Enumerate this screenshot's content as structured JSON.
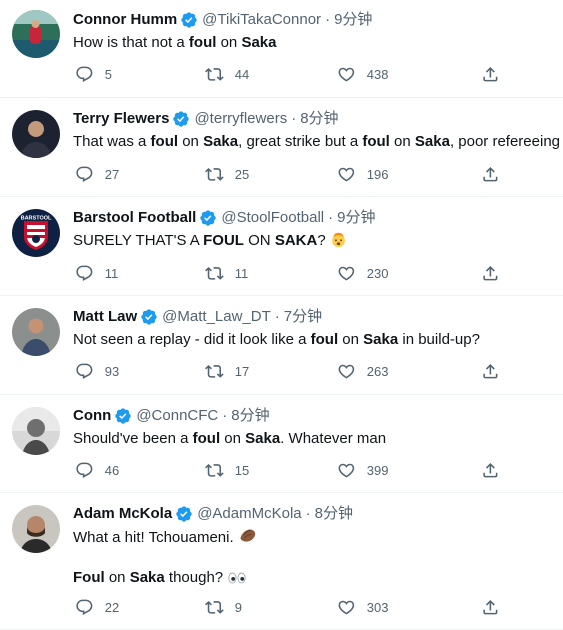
{
  "tweets": [
    {
      "name": "Connor Humm",
      "handle": "@TikiTakaConnor",
      "time": "9分钟",
      "segments": [
        {
          "t": "How is that not a "
        },
        {
          "t": "foul",
          "b": true
        },
        {
          "t": " on "
        },
        {
          "t": "Saka",
          "b": true
        }
      ],
      "replies": "5",
      "retweets": "44",
      "likes": "438"
    },
    {
      "name": "Terry Flewers",
      "handle": "@terryflewers",
      "time": "8分钟",
      "segments": [
        {
          "t": "That was a "
        },
        {
          "t": "foul",
          "b": true
        },
        {
          "t": " on "
        },
        {
          "t": "Saka",
          "b": true
        },
        {
          "t": ", great strike but a "
        },
        {
          "t": "foul",
          "b": true
        },
        {
          "t": " on "
        },
        {
          "t": "Saka",
          "b": true
        },
        {
          "t": ", poor refereeing"
        }
      ],
      "replies": "27",
      "retweets": "25",
      "likes": "196"
    },
    {
      "name": "Barstool Football",
      "handle": "@StoolFootball",
      "time": "9分钟",
      "segments": [
        {
          "t": "SURELY THAT'S A "
        },
        {
          "t": "FOUL",
          "b": true
        },
        {
          "t": " ON "
        },
        {
          "t": "SAKA",
          "b": true
        },
        {
          "t": "? "
        }
      ],
      "emoji": "exploding-head-emoji",
      "replies": "11",
      "retweets": "11",
      "likes": "230"
    },
    {
      "name": "Matt Law",
      "handle": "@Matt_Law_DT",
      "time": "7分钟",
      "segments": [
        {
          "t": "Not seen a replay - did it look like a "
        },
        {
          "t": "foul",
          "b": true
        },
        {
          "t": " on "
        },
        {
          "t": "Saka",
          "b": true
        },
        {
          "t": " in build-up?"
        }
      ],
      "replies": "93",
      "retweets": "17",
      "likes": "263"
    },
    {
      "name": "Conn",
      "handle": "@ConnCFC",
      "time": "8分钟",
      "segments": [
        {
          "t": "Should've been a "
        },
        {
          "t": "foul",
          "b": true
        },
        {
          "t": " on "
        },
        {
          "t": "Saka",
          "b": true
        },
        {
          "t": ". Whatever man"
        }
      ],
      "replies": "46",
      "retweets": "15",
      "likes": "399"
    },
    {
      "name": "Adam McKola",
      "handle": "@AdamMcKola",
      "time": "8分钟",
      "segments": [
        {
          "t": "What a hit! Tchouameni. "
        }
      ],
      "emoji": "clapping-hands-emoji",
      "segments2": [
        {
          "t": "Foul",
          "b": true
        },
        {
          "t": " on "
        },
        {
          "t": "Saka",
          "b": true
        },
        {
          "t": " though? "
        }
      ],
      "emoji2": "eyes-emoji",
      "replies": "22",
      "retweets": "9",
      "likes": "303"
    }
  ],
  "colors": {
    "verified": "#1d9bf0",
    "muted": "#536471",
    "text": "#0f1419",
    "divider": "#eff3f4"
  }
}
